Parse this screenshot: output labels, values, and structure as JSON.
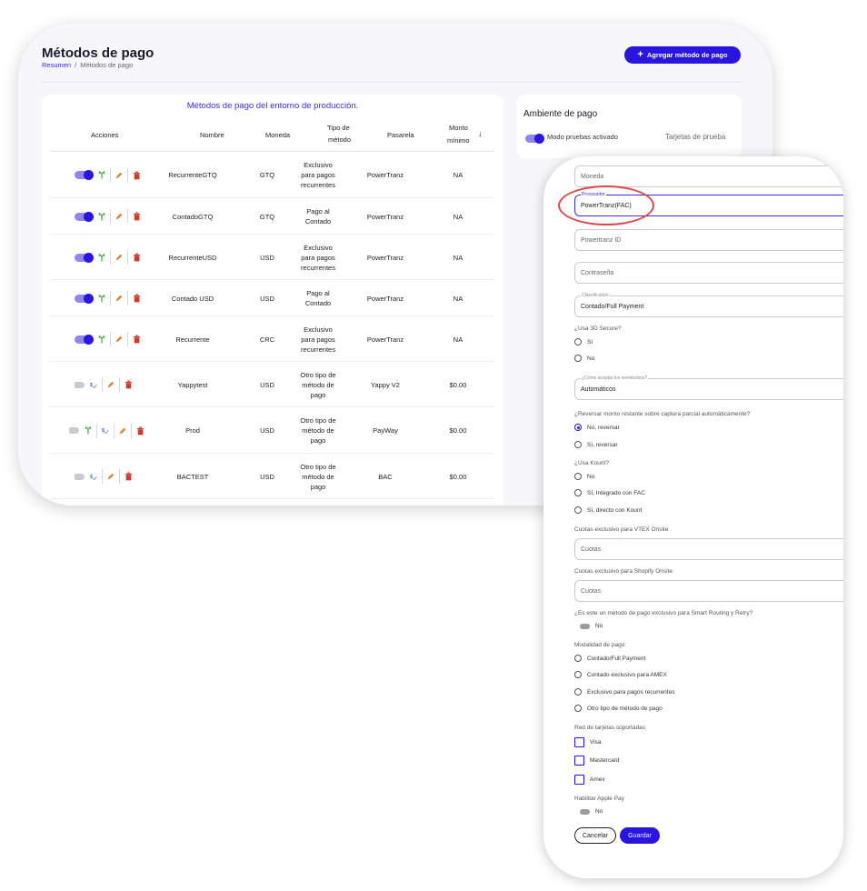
{
  "header": {
    "title": "Métodos de pago",
    "breadcrumb_home": "Resumen",
    "breadcrumb_sep": "/",
    "breadcrumb_current": "Métodos de pago",
    "add_button": "Agregar método de pago"
  },
  "table": {
    "title": "Métodos de pago del entorno de producción.",
    "headers": {
      "actions": "Acciones",
      "name": "Nombre",
      "currency": "Moneda",
      "type_line1": "Tipo de",
      "type_line2": "método",
      "gateway": "Pasarela",
      "min_line1": "Monto",
      "min_line2": "mínimo",
      "sort_icon": "arrow-down-icon"
    },
    "rows": [
      {
        "name": "RecurrenteGTQ",
        "currency": "GTQ",
        "type": [
          "Exclusivo",
          "para pagos",
          "recurrentes"
        ],
        "gateway": "PowerTranz",
        "min": "NA",
        "enabled": true,
        "icons": [
          "merge-icon"
        ]
      },
      {
        "name": "ContadoGTQ",
        "currency": "GTQ",
        "type": [
          "Pago al",
          "Contado"
        ],
        "gateway": "PowerTranz",
        "min": "NA",
        "enabled": true,
        "icons": [
          "merge-icon"
        ]
      },
      {
        "name": "RecurrenteUSD",
        "currency": "USD",
        "type": [
          "Exclusivo",
          "para pagos",
          "recurrentes"
        ],
        "gateway": "PowerTranz",
        "min": "NA",
        "enabled": true,
        "icons": [
          "merge-icon"
        ]
      },
      {
        "name": "Contado USD",
        "currency": "USD",
        "type": [
          "Pago al",
          "Contado"
        ],
        "gateway": "PowerTranz",
        "min": "NA",
        "enabled": true,
        "icons": [
          "merge-icon"
        ]
      },
      {
        "name": "Recurrente",
        "currency": "CRC",
        "type": [
          "Exclusivo",
          "para pagos",
          "recurrentes"
        ],
        "gateway": "PowerTranz",
        "min": "NA",
        "enabled": true,
        "icons": [
          "merge-icon"
        ]
      },
      {
        "name": "Yappytest",
        "currency": "USD",
        "type": [
          "Otro tipo de",
          "método de",
          "pago"
        ],
        "gateway": "Yappy V2",
        "min": "$0.00",
        "enabled": false,
        "icons": [
          "dollar-check-icon"
        ]
      },
      {
        "name": "Prod",
        "currency": "USD",
        "type": [
          "Otro tipo de",
          "método de",
          "pago"
        ],
        "gateway": "PayWay",
        "min": "$0.00",
        "enabled": false,
        "icons": [
          "merge-icon",
          "dollar-check-icon"
        ]
      },
      {
        "name": "BACTEST",
        "currency": "USD",
        "type": [
          "Otro tipo de",
          "método de",
          "pago"
        ],
        "gateway": "BAC",
        "min": "$0.00",
        "enabled": false,
        "icons": [
          "dollar-check-icon"
        ]
      }
    ]
  },
  "environment": {
    "title": "Ambiente de pago",
    "toggle_label": "Modo pruebas activado",
    "test_cards_link": "Tarjetas de prueba"
  },
  "form": {
    "currency_placeholder": "Moneda",
    "processor_label": "Procesador",
    "processor_value": "PowerTranz(FAC)",
    "powertranz_id_placeholder": "Powertranz ID",
    "password_placeholder": "Contraseña",
    "classification_label": "Classification",
    "classification_value": "Contado/Full Payment",
    "q_3ds": "¿Usa 3D Secure?",
    "opt_yes": "Sí",
    "opt_no": "No",
    "refunds_label": "¿Cómo aceptar los reembolsos?",
    "refunds_value": "Automáticos",
    "q_reverse": "¿Reversar monto restante sobre captura parcial automáticamente?",
    "reverse_no": "No, reversar",
    "reverse_yes": "Sí, reversar",
    "q_kount": "¿Usa Kount?",
    "kount_no": "No",
    "kount_fac": "Sí, Integrado con FAC",
    "kount_direct": "Sí, directo con Kount",
    "vtex_label": "Cuotas exclusivo para VTEX Onsite",
    "vtex_placeholder": "Cuotas",
    "shopify_label": "Cuotas exclusivo para Shopify Onsite",
    "shopify_placeholder": "Cuotas",
    "q_smart": "¿Es este un método de pago exclusivo para Smart Routing y Retry?",
    "smart_value": "No",
    "modality_label": "Modalidad de pago:",
    "modality_options": [
      "Contado/Full Payment",
      "Contado exclusivo para AMEX",
      "Exclusivo para pagos recurrentes",
      "Otro tipo de método de pago"
    ],
    "cards_label": "Red de tarjetas soportadas",
    "cards": [
      "Visa",
      "Mastercard",
      "Amex"
    ],
    "apple_pay_label": "Habilitar Apple Pay",
    "apple_pay_value": "No",
    "cancel_button": "Cancelar",
    "save_button": "Guardar"
  },
  "colors": {
    "accent": "#2a14e0",
    "highlight": "#e0484a",
    "split_icon": "#3aaa35",
    "edit_icon": "#e07a2a",
    "delete_icon": "#d03a2a"
  }
}
